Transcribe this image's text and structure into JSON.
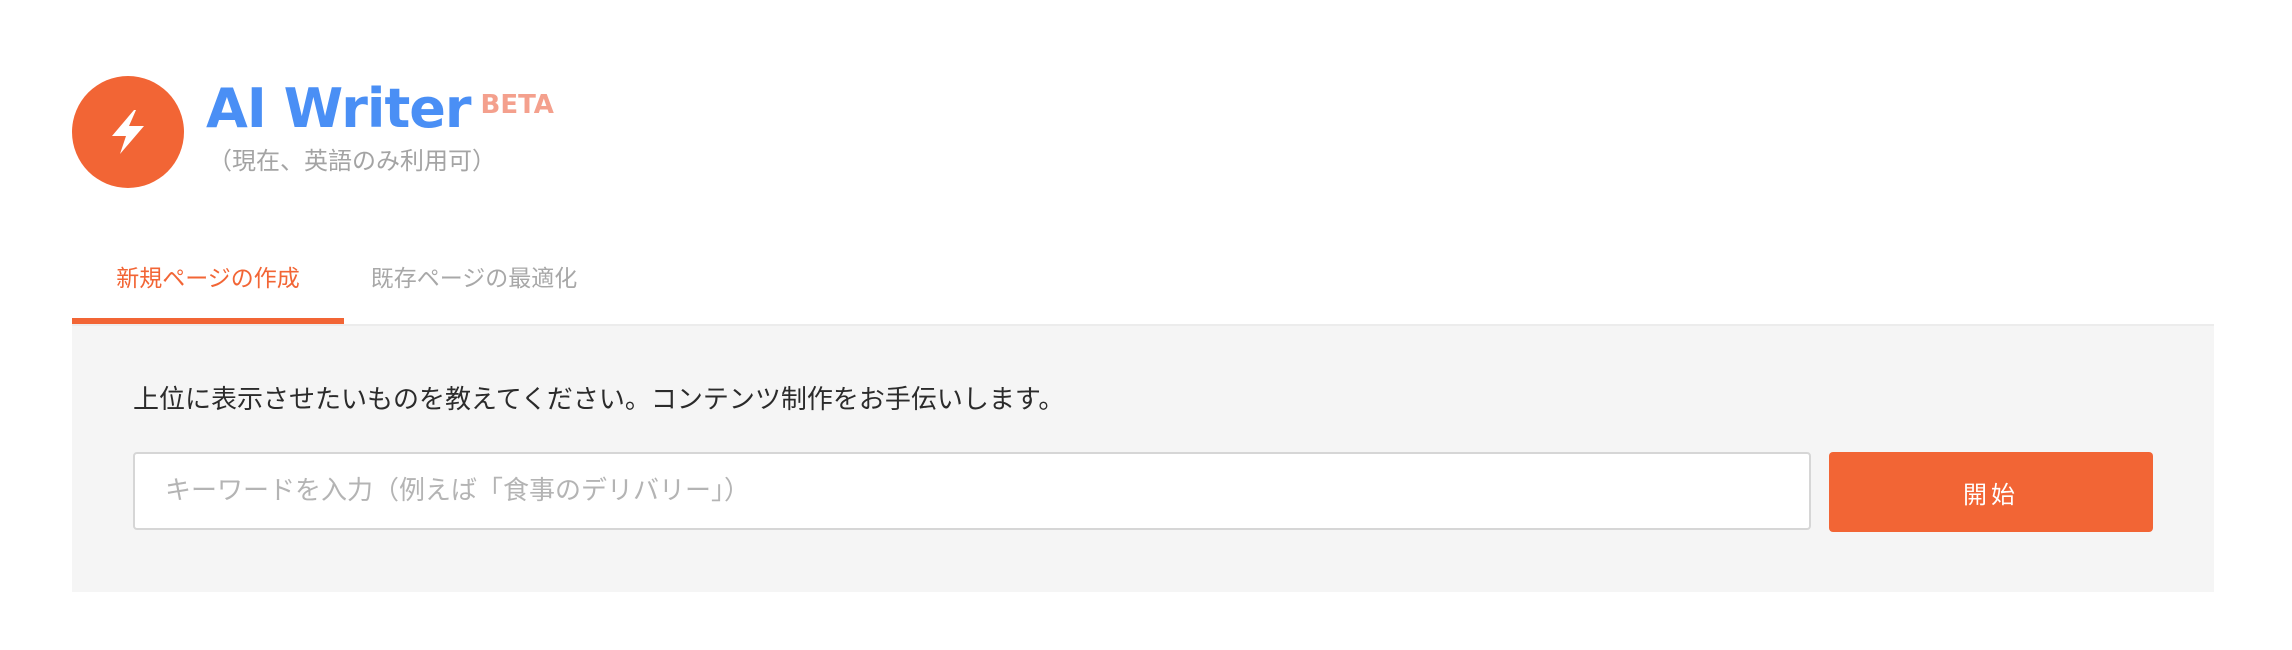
{
  "header": {
    "logo_icon": "lightning-bolt-icon",
    "title": "AI Writer",
    "badge": "BETA",
    "subtitle": "（現在、英語のみ利用可）"
  },
  "tabs": [
    {
      "label": "新規ページの作成",
      "active": true
    },
    {
      "label": "既存ページの最適化",
      "active": false
    }
  ],
  "panel": {
    "instruction": "上位に表示させたいものを教えてください。コンテンツ制作をお手伝いします。",
    "input": {
      "value": "",
      "placeholder": "キーワードを入力（例えば「食事のデリバリー」）"
    },
    "start_button_label": "開始"
  },
  "colors": {
    "accent": "#f26535",
    "title_blue": "#4a8ff5",
    "beta": "#f4a08d",
    "panel_bg": "#f5f5f5"
  }
}
